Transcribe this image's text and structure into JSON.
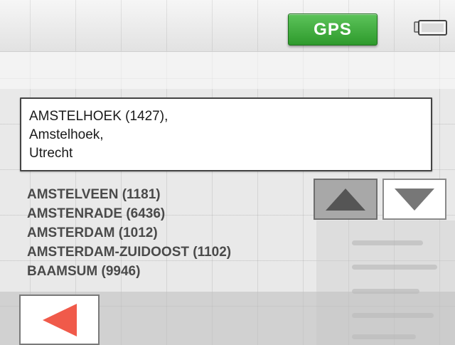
{
  "header": {
    "gps_label": "GPS",
    "battery_icon": "battery-icon",
    "gps_color": "#3aa838"
  },
  "selection": {
    "lines": [
      "AMSTELHOEK (1427),",
      "Amstelhoek,",
      "Utrecht"
    ]
  },
  "results": {
    "items": [
      "AMSTELVEEN (1181)",
      "AMSTENRADE (6436)",
      "AMSTERDAM (1012)",
      "AMSTERDAM-ZUIDOOST (1102)",
      "BAAMSUM (9946)"
    ]
  },
  "controls": {
    "up_icon": "arrow-up-icon",
    "down_icon": "arrow-down-icon",
    "back_icon": "back-arrow-icon",
    "back_color": "#f05a4a"
  }
}
